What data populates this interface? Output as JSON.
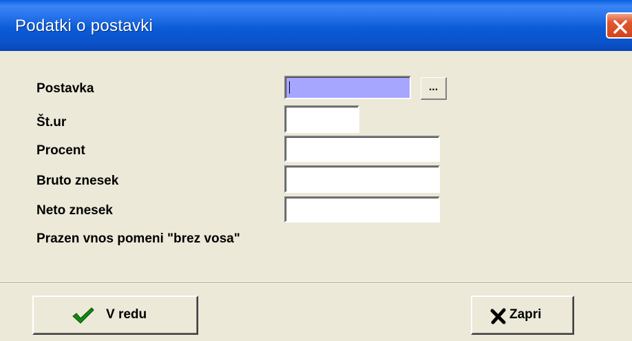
{
  "window": {
    "title": "Podatki o postavki"
  },
  "form": {
    "fields": [
      {
        "label": "Postavka",
        "value": ""
      },
      {
        "label": "Št.ur",
        "value": ""
      },
      {
        "label": "Procent",
        "value": ""
      },
      {
        "label": "Bruto znesek",
        "value": ""
      },
      {
        "label": "Neto znesek",
        "value": ""
      }
    ],
    "browse_label": "...",
    "note": "Prazen vnos pomeni \"brez vosa\""
  },
  "buttons": {
    "ok_label": "V redu",
    "close_label": "Zapri"
  },
  "colors": {
    "title_bar": "#0a5fe0",
    "active_field": "#a6a6ff",
    "ok_check": "#0f8a0f",
    "close_x": "#000000"
  },
  "icons": {
    "ok": "check-icon",
    "close": "x-icon",
    "window_close": "close-icon"
  }
}
